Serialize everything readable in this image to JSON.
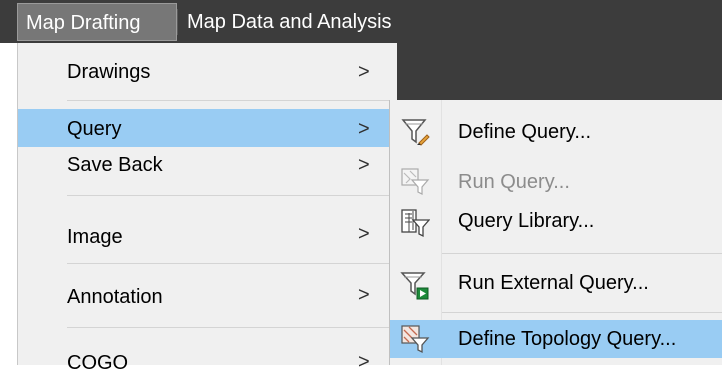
{
  "menubar": {
    "items": [
      {
        "label": "Map Drafting",
        "active": true
      },
      {
        "label": "Map Data and Analysis",
        "active": false
      }
    ]
  },
  "main_menu": {
    "items": [
      {
        "label": "Drawings",
        "arrow": ">"
      },
      {
        "label": "Query",
        "arrow": ">",
        "highlighted": true
      },
      {
        "label": "Save Back",
        "arrow": ">"
      },
      {
        "label": "Image",
        "arrow": ">"
      },
      {
        "label": "Annotation",
        "arrow": ">"
      },
      {
        "label": "COGO",
        "arrow": ">"
      }
    ]
  },
  "query_submenu": {
    "items": [
      {
        "label": "Define Query...",
        "icon": "define-query-icon",
        "enabled": true
      },
      {
        "label": "Run Query...",
        "icon": "run-query-icon",
        "enabled": false
      },
      {
        "label": "Query Library...",
        "icon": "query-library-icon",
        "enabled": true
      },
      {
        "label": "Run External Query...",
        "icon": "run-external-query-icon",
        "enabled": true
      },
      {
        "label": "Define Topology Query...",
        "icon": "define-topology-query-icon",
        "enabled": true,
        "highlighted": true
      }
    ]
  },
  "colors": {
    "menubar_bg": "#3c3c3c",
    "menu_bg": "#f0f0f0",
    "highlight": "#99ccf3",
    "disabled_text": "#8c8c8c"
  }
}
